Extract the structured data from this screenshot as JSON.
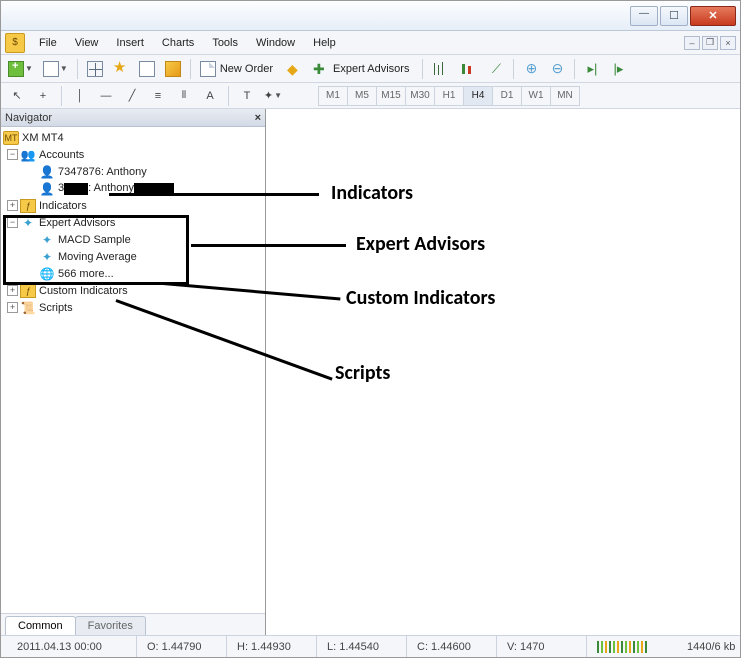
{
  "menu": {
    "file": "File",
    "view": "View",
    "insert": "Insert",
    "charts": "Charts",
    "tools": "Tools",
    "window": "Window",
    "help": "Help"
  },
  "toolbar": {
    "new_order": "New Order",
    "expert_advisors": "Expert Advisors"
  },
  "timeframes": [
    "M1",
    "M5",
    "M15",
    "M30",
    "H1",
    "H4",
    "D1",
    "W1",
    "MN"
  ],
  "active_tf": "H4",
  "navigator": {
    "title": "Navigator",
    "root": "XM MT4",
    "accounts_label": "Accounts",
    "accounts": [
      {
        "id": "7347876",
        "name": "Anthony"
      },
      {
        "id": "3",
        "name": "Anthony",
        "redact_id": true,
        "redact_after": true
      }
    ],
    "indicators": "Indicators",
    "expert_advisors": "Expert Advisors",
    "ea_items": [
      "MACD Sample",
      "Moving Average"
    ],
    "ea_more": "566 more...",
    "custom_indicators": "Custom Indicators",
    "scripts": "Scripts",
    "tabs": {
      "common": "Common",
      "favorites": "Favorites"
    }
  },
  "annotations": {
    "indicators": "Indicators",
    "expert_advisors": "Expert Advisors",
    "custom_indicators": "Custom Indicators",
    "scripts": "Scripts"
  },
  "status": {
    "datetime": "2011.04.13 00:00",
    "open": "O: 1.44790",
    "high": "H: 1.44930",
    "low": "L: 1.44540",
    "close": "C: 1.44600",
    "volume": "V: 1470",
    "net": "1440/6 kb"
  }
}
